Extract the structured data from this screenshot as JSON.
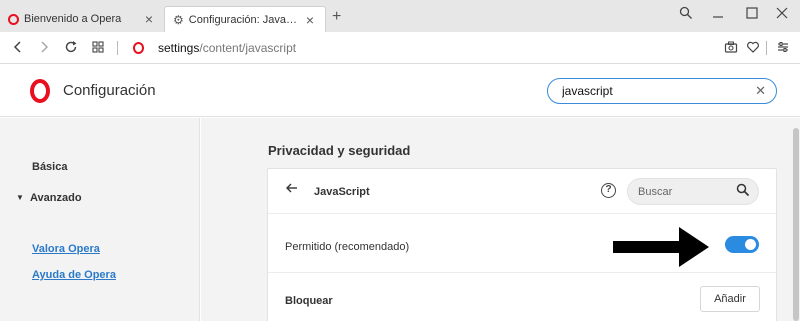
{
  "tabs": [
    {
      "label": "Bienvenido a Opera",
      "icon": "opera-logo-icon"
    },
    {
      "label": "Configuración: JavaScript",
      "icon": "gear-icon"
    }
  ],
  "toolbar": {
    "new_tab": "+",
    "url_host": "settings",
    "url_path": "/content/javascript"
  },
  "window_controls": {
    "search": "⚲",
    "minimize": "—",
    "maximize": "☐",
    "close": "✕"
  },
  "header": {
    "title": "Configuración",
    "search_value": "javascript"
  },
  "sidebar": {
    "basic": "Básica",
    "advanced": "Avanzado",
    "links": [
      "Valora Opera",
      "Ayuda de Opera"
    ]
  },
  "main": {
    "section_title": "Privacidad y seguridad",
    "card": {
      "title": "JavaScript",
      "search_placeholder": "Buscar",
      "allowed_label": "Permitido (recomendado)",
      "allowed_enabled": true,
      "block_label": "Bloquear",
      "add_button": "Añadir"
    }
  },
  "colors": {
    "accent": "#2a8be0",
    "opera_red": "#e8101f",
    "link": "#2a7ac9"
  }
}
